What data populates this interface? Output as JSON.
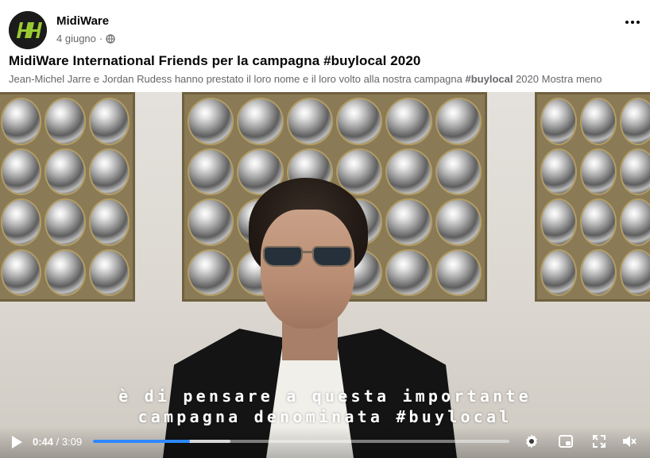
{
  "post": {
    "page_name": "MidiWare",
    "date": "4 giugno",
    "separator": "·",
    "privacy_icon": "globe-icon",
    "more_icon": "more-options-icon",
    "title": "MidiWare International Friends per la campagna #buylocal 2020",
    "description_before": "Jean-Michel Jarre e Jordan Rudess hanno prestato il loro nome e il loro volto alla nostra campagna ",
    "description_hashtag": "#buylocal",
    "description_after": " 2020 ",
    "description_toggle": "Mostra meno"
  },
  "video": {
    "subtitle_line1": "è di pensare a questa importante",
    "subtitle_line2": "campagna denominata #buylocal",
    "current_time": "0:44",
    "time_separator": " / ",
    "duration": "3:09",
    "played_fraction": 0.233,
    "buffered_fraction": 0.33,
    "accent_color": "#2d88ff",
    "controls": {
      "play_icon": "play-icon",
      "settings_icon": "gear-icon",
      "pip_icon": "picture-in-picture-icon",
      "fullscreen_icon": "fullscreen-icon",
      "volume_icon": "volume-muted-icon"
    }
  }
}
